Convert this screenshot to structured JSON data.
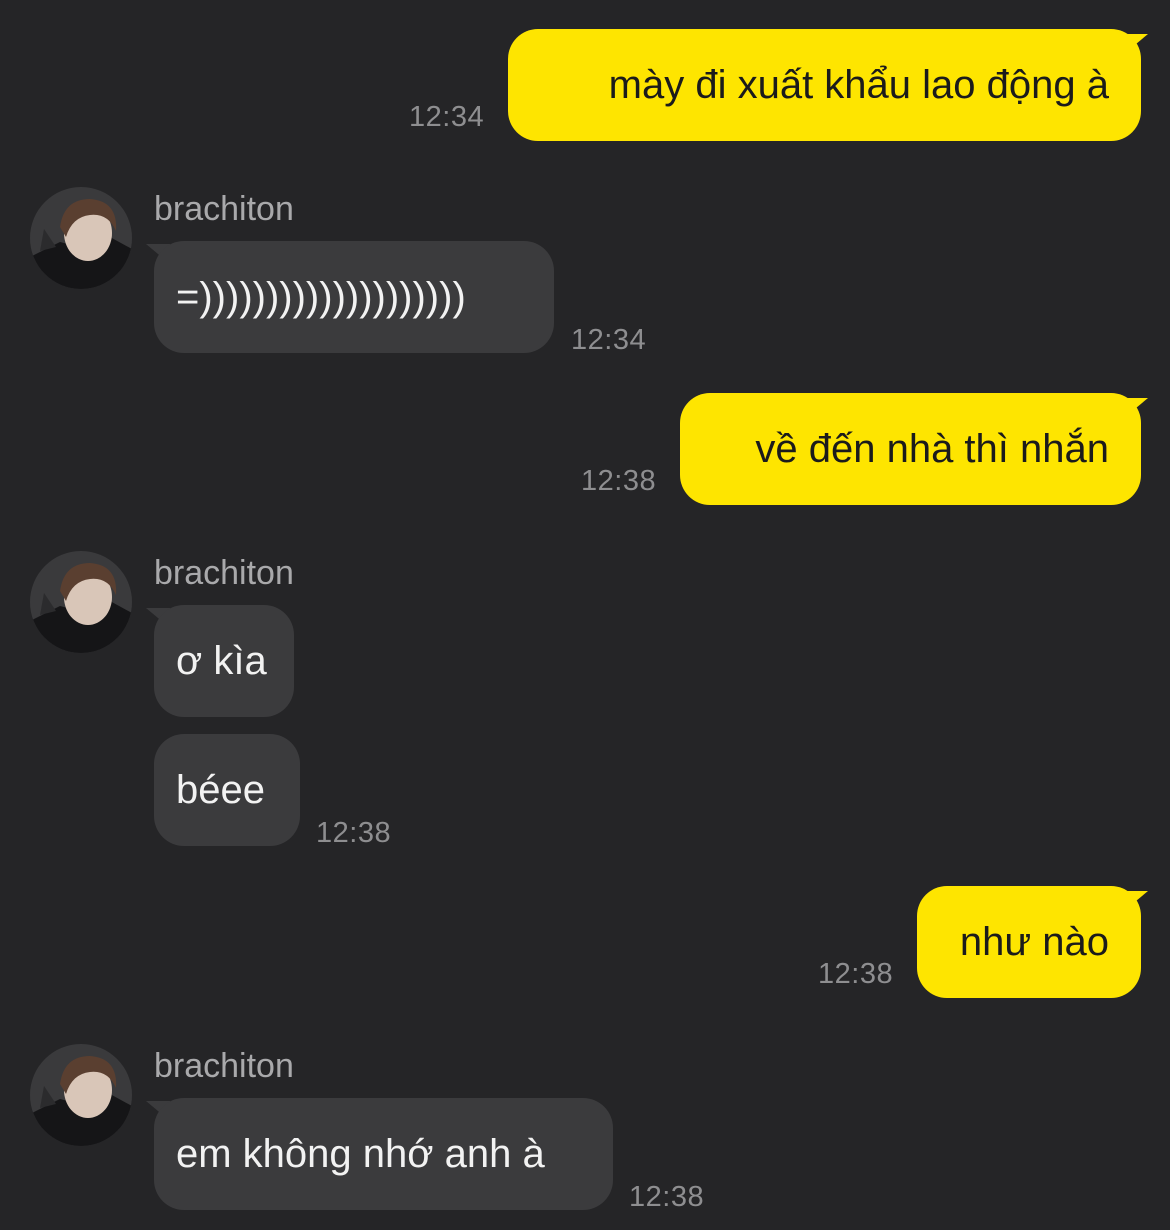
{
  "contact": {
    "name": "brachiton"
  },
  "messages": [
    {
      "direction": "sent",
      "text": "mày đi xuất khẩu lao động à",
      "time": "12:34"
    },
    {
      "direction": "received",
      "text": "=))))))))))))))))))))",
      "time": "12:34"
    },
    {
      "direction": "sent",
      "text": "về đến nhà thì nhắn",
      "time": "12:38"
    },
    {
      "direction": "received",
      "text": "ơ kìa",
      "time": ""
    },
    {
      "direction": "received",
      "text": "béee",
      "time": "12:38"
    },
    {
      "direction": "sent",
      "text": "như nào",
      "time": "12:38"
    },
    {
      "direction": "received",
      "text": "em không nhớ anh à",
      "time": "12:38"
    }
  ],
  "colors": {
    "background": "#252527",
    "sent_bubble": "#FEE500",
    "received_bubble": "#3b3b3d",
    "timestamp": "#8e8e90"
  },
  "icons": {
    "avatar": "user-avatar-photo"
  }
}
